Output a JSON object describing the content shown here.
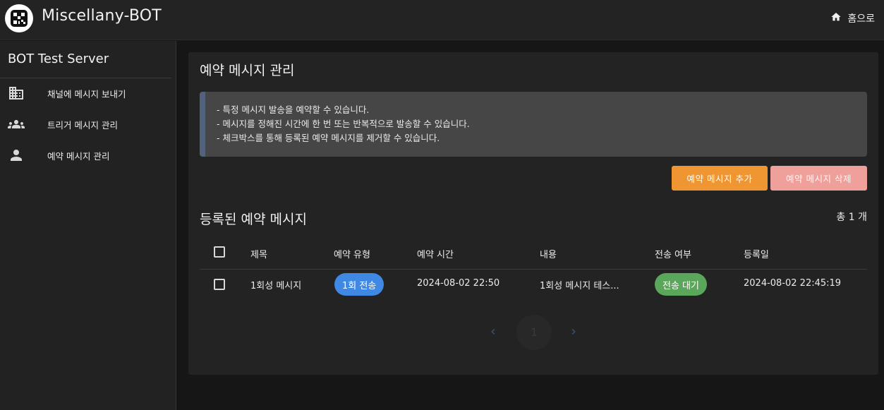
{
  "app": {
    "title": "Miscellany-BOT",
    "home_label": "홈으로"
  },
  "sidebar": {
    "server_name": "BOT Test Server",
    "items": [
      {
        "label": "채널에 메시지 보내기",
        "icon": "domain-icon"
      },
      {
        "label": "트리거 메시지 관리",
        "icon": "group-icon"
      },
      {
        "label": "예약 메시지 관리",
        "icon": "person-icon"
      }
    ]
  },
  "main": {
    "title": "예약 메시지 관리",
    "info_lines": [
      "- 특정 메시지 발송을 예약할 수 있습니다.",
      "- 메시지를 정해진 시간에 한 번 또는 반복적으로 발송할 수 있습니다.",
      "- 체크박스를 통해 등록된 예약 메시지를 제거할 수 있습니다."
    ],
    "add_button": "예약 메시지 추가",
    "delete_button": "예약 메시지 삭제",
    "section_title": "등록된 예약 메시지",
    "total_count": "총 1 개",
    "columns": [
      "제목",
      "예약 유형",
      "예약 시간",
      "내용",
      "전송 여부",
      "등록일"
    ],
    "rows": [
      {
        "title": "1회성 메시지",
        "type": "1회 전송",
        "time": "2024-08-02 22:50",
        "content": "1회성 메시지 테스...",
        "status": "전송 대기",
        "registered": "2024-08-02 22:45:19"
      }
    ],
    "pagination": {
      "current_page": "1"
    }
  },
  "colors": {
    "accent_add": "#ef9532",
    "accent_delete": "#f0a09b",
    "chip_type": "#3f88e4",
    "chip_status": "#5aa65a",
    "info_border": "#52627c"
  }
}
